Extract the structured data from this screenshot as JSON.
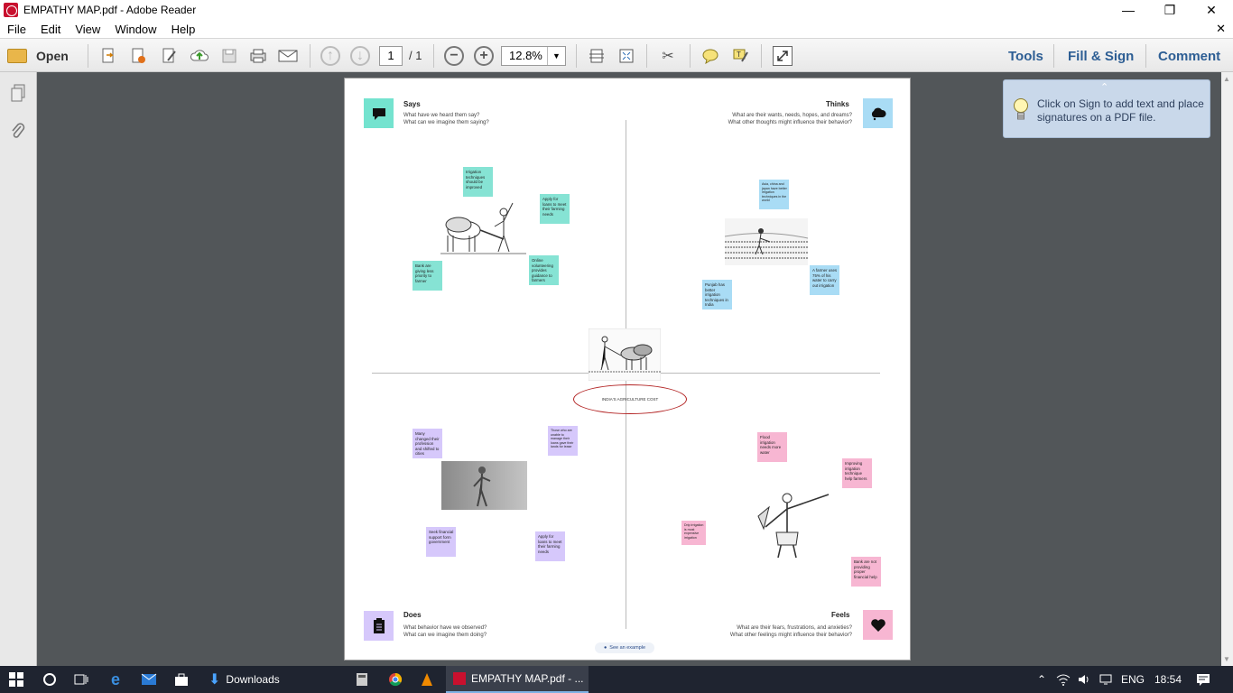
{
  "window": {
    "title": "EMPATHY MAP.pdf - Adobe Reader",
    "minimize": "—",
    "restore": "❐",
    "close": "✕"
  },
  "menu": {
    "items": [
      "File",
      "Edit",
      "View",
      "Window",
      "Help"
    ],
    "close_doc": "✕"
  },
  "toolbar": {
    "open_label": "Open",
    "page_current": "1",
    "page_total": "/ 1",
    "zoom": "12.8%",
    "tools_label": "Tools",
    "fill_sign_label": "Fill & Sign",
    "comment_label": "Comment"
  },
  "tooltip": {
    "text": "Click on Sign to add text and place signatures on a PDF file."
  },
  "page": {
    "says": {
      "title": "Says",
      "sub1": "What have we heard them say?",
      "sub2": "What can we imagine them saying?",
      "icon": "speech-bubble-icon",
      "color": "#74e3cf"
    },
    "thinks": {
      "title": "Thinks",
      "sub1": "What are their wants, needs, hopes, and dreams?",
      "sub2": "What other thoughts might influence their behavior?",
      "icon": "thought-cloud-icon",
      "color": "#a9dcf5"
    },
    "does": {
      "title": "Does",
      "sub1": "What behavior have we observed?",
      "sub2": "What can we imagine them doing?",
      "icon": "clipboard-icon",
      "color": "#d6c8fb"
    },
    "feels": {
      "title": "Feels",
      "sub1": "What are their fears, frustrations, and anxieties?",
      "sub2": "What other feelings might influence their behavior?",
      "icon": "heart-icon",
      "color": "#f7b6d2"
    },
    "center_label": "INDIA'S AGRICULTURE COST",
    "see_example": "See an example",
    "notes": {
      "says1": "Irrigation techniques should be improved",
      "says2": "Apply for loans to meet their farming needs",
      "says3": "Bank are giving less priority to farmer",
      "says4": "Online volunteering provides guidance to farmers",
      "thinks1": "Asia, china and japan have better irrigation techniques in the world",
      "thinks2": "A farmer uses 75% of his water to carry out irrigation",
      "thinks3": "Punjab has better irrigation techniques in India",
      "does1": "Many changed their profession and shifted to cities",
      "does2": "Those who are unable to manage their loans gave their lands for lease",
      "does3": "Seek financial support form government",
      "does4": "Apply for loans to meet their farming needs",
      "feels1": "Flood irrigation needs more water",
      "feels2": "Improving irrigation technique help farmers",
      "feels3": "Drip irrigation is most expensive irrigation",
      "feels4": "Bank are not providing proper financial help"
    }
  },
  "taskbar": {
    "downloads": "Downloads",
    "active_app": "EMPATHY MAP.pdf - ...",
    "lang": "ENG",
    "time": "18:54"
  }
}
